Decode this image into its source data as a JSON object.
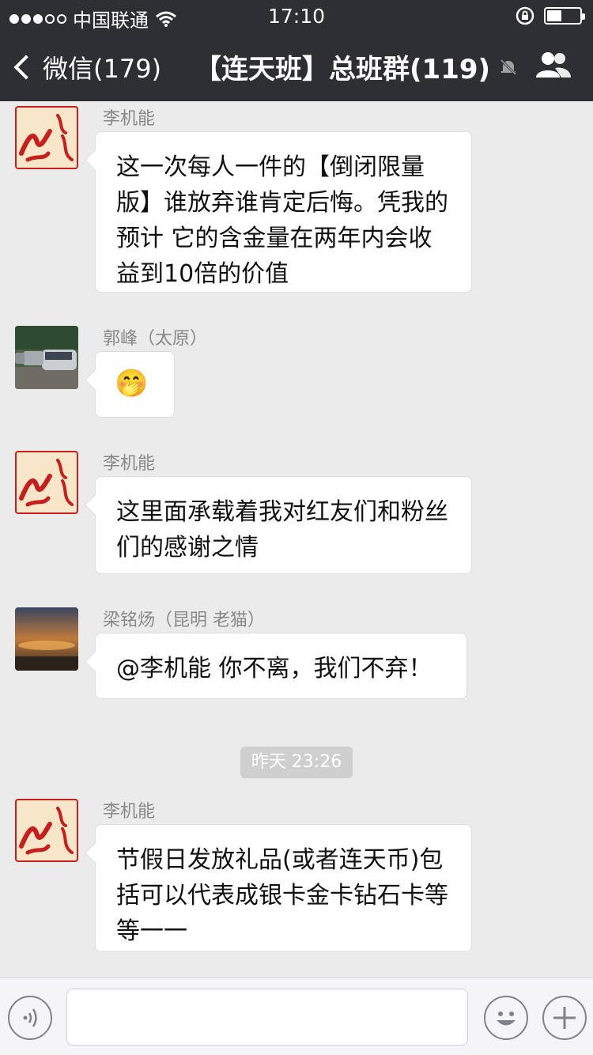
{
  "status": {
    "carrier": "中国联通",
    "time": "17:10",
    "battery_level": 0.45
  },
  "nav": {
    "back_label": "微信(179)",
    "title": "【连天班】总班群(119)"
  },
  "messages": [
    {
      "sender": "李机能",
      "text": "这一次每人一件的【倒闭限量版】谁放弃谁肯定后悔。凭我的预计 它的含金量在两年内会收益到10倍的价值",
      "avatar": "hong-avatar"
    },
    {
      "sender": "郭峰（太原）",
      "text": "🤭",
      "avatar": "cars-photo-avatar"
    },
    {
      "sender": "李机能",
      "text": "这里面承载着我对红友们和粉丝们的感谢之情",
      "avatar": "hong-avatar"
    },
    {
      "sender": "梁铭炀（昆明 老猫）",
      "text": "@李机能 你不离，我们不弃！",
      "avatar": "sunset-photo-avatar"
    },
    {
      "sender": "李机能",
      "text": "节假日发放礼品(或者连天币)包括可以代表成银卡金卡钻石卡等等一一",
      "avatar": "hong-avatar"
    }
  ],
  "timestamp": "昨天 23:26",
  "colors": {
    "nav_bg": "#2e2f33",
    "chat_bg": "#ebebeb",
    "bubble": "#ffffff",
    "brand_red": "#c71e1e"
  },
  "icons": [
    "wifi-icon",
    "lock-rotation-icon",
    "battery-icon",
    "back-chevron-icon",
    "mute-bell-icon",
    "group-members-icon",
    "voice-icon",
    "emoji-icon",
    "plus-icon"
  ]
}
